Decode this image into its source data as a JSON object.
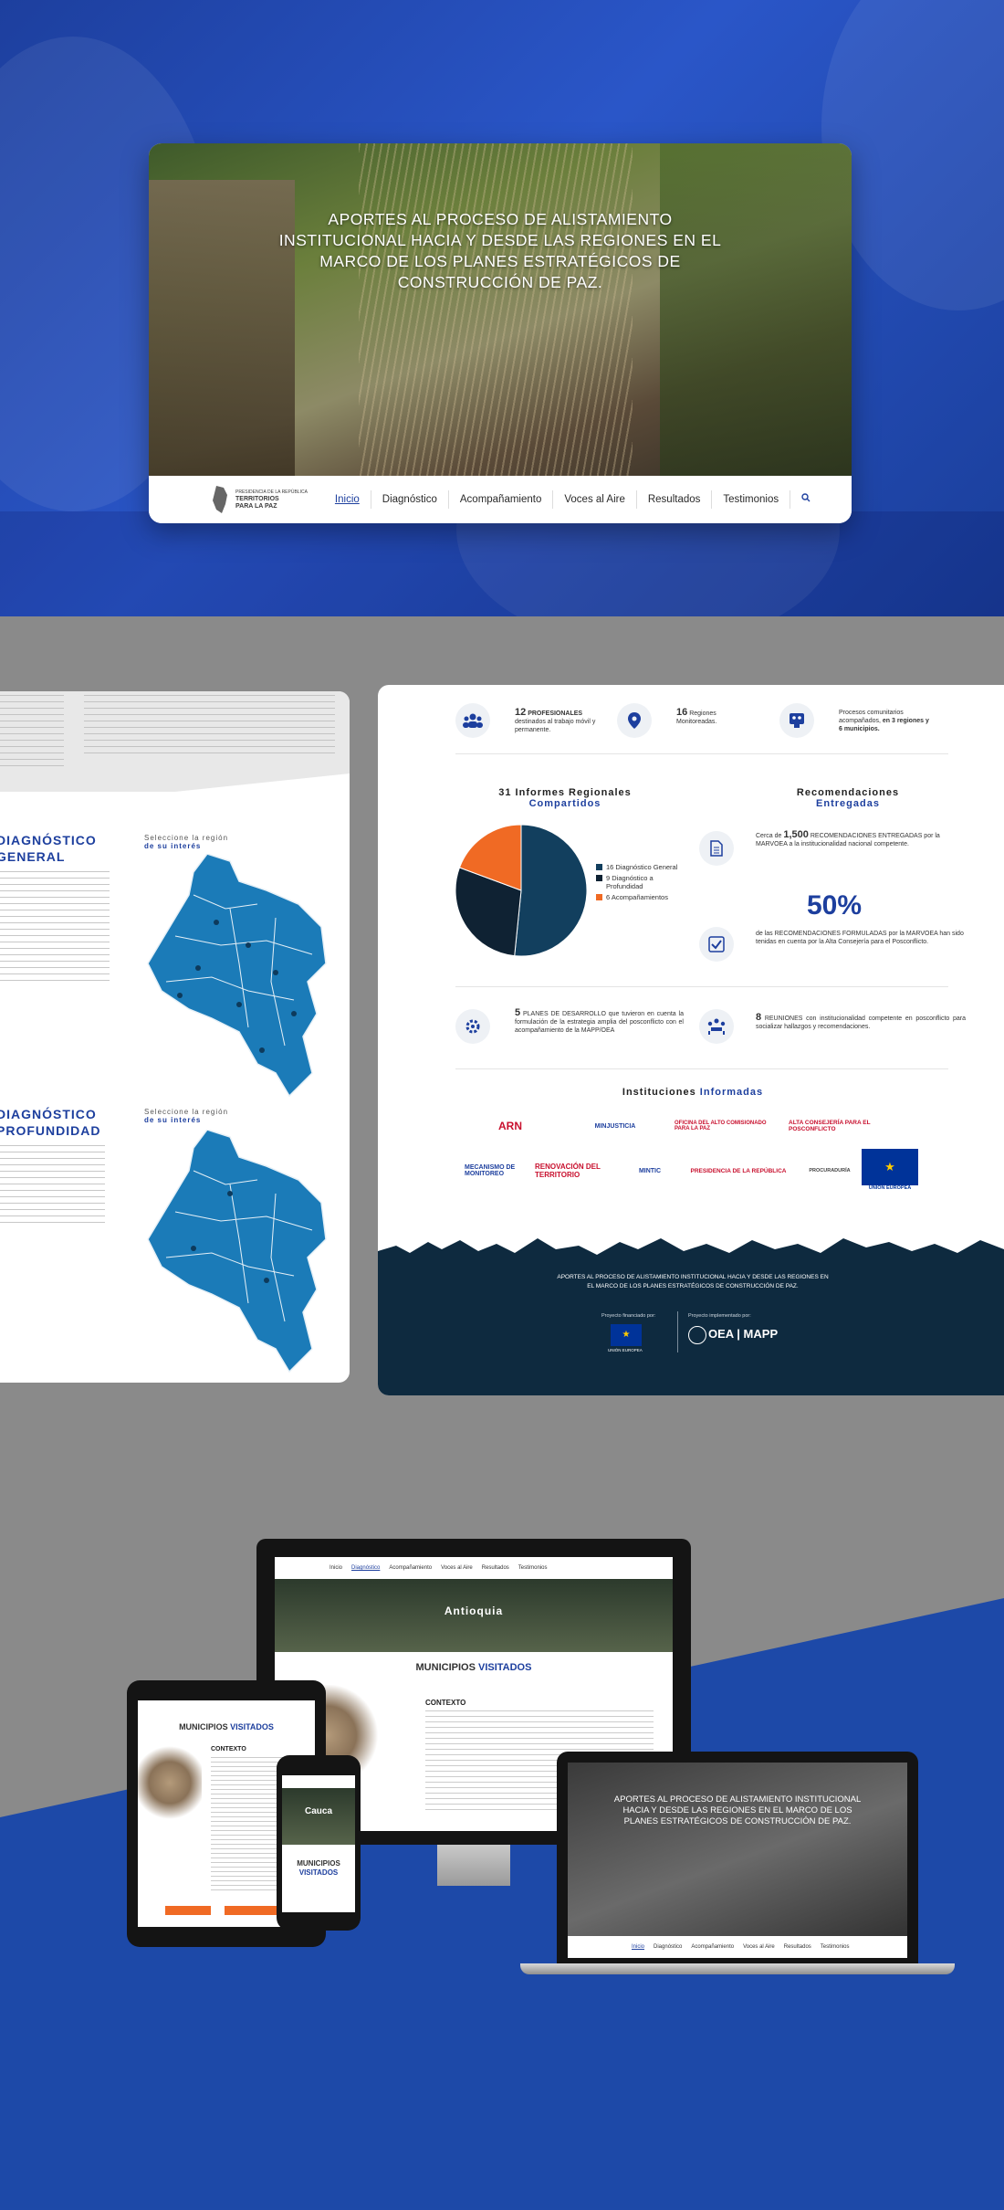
{
  "hero": {
    "title": "APORTES AL PROCESO DE ALISTAMIENTO INSTITUCIONAL HACIA Y DESDE LAS REGIONES EN EL MARCO DE LOS PLANES ESTRATÉGICOS DE CONSTRUCCIÓN DE PAZ.",
    "logo_line1": "PRESIDENCIA DE LA REPÚBLICA",
    "logo_line2": "TERRITORIOS",
    "logo_line3": "PARA LA PAZ",
    "nav": [
      "Inicio",
      "Diagnóstico",
      "Acompañamiento",
      "Voces al Aire",
      "Resultados",
      "Testimonios"
    ]
  },
  "left_panel": {
    "diag1_title": "DIAGNÓSTICO",
    "diag1_sub": "GENERAL",
    "diag2_title": "DIAGNÓSTICO",
    "diag2_sub": "PROFUNDIDAD",
    "select1_a": "Seleccione la región",
    "select1_b": "de su interés",
    "select2_a": "Seleccione la región",
    "select2_b": "de su interés",
    "map_color": "#1b7bb8"
  },
  "stats": {
    "s1_num": "12",
    "s1_label": "PROFESIONALES",
    "s1_desc": "destinados al trabajo móvil y permanente.",
    "s2_num": "16",
    "s2_label": "Regiones Monitoreadas.",
    "s3_desc": "Procesos comunitarios acompañados,",
    "s3_bold": "en 3 regiones y 6 municipios."
  },
  "informes": {
    "title_a": "31 Informes Regionales",
    "title_b": "Compartidos"
  },
  "chart_data": {
    "type": "pie",
    "categories": [
      "16 Diagnóstico General",
      "9 Diagnóstico a Profundidad",
      "6 Acompañamientos"
    ],
    "values": [
      16,
      9,
      6
    ],
    "colors": [
      "#123f5e",
      "#0f2233",
      "#f06a24"
    ]
  },
  "recomendaciones": {
    "title_a": "Recomendaciones",
    "title_b": "Entregadas",
    "r1_pre": "Cerca de",
    "r1_num": "1,500",
    "r1_text": "RECOMENDACIONES ENTREGADAS por la MARVOEA a la institucionalidad nacional competente.",
    "pct": "50%",
    "r2_text": "de las RECOMENDACIONES FORMULADAS por la MARVOEA han sido tenidas en cuenta por la Alta Consejería para el Posconflicto."
  },
  "planes": {
    "num": "5",
    "text": "PLANES DE DESARROLLO que tuvieron en cuenta la formulación de la estrategia amplia del posconflicto con el acompañamiento de la MAPP/OEA",
    "r_num": "8",
    "r_text": "REUNIONES con institucionalidad competente en posconflicto para socializar hallazgos y recomendaciones."
  },
  "instituciones": {
    "title_a": "Instituciones",
    "title_b": "Informadas",
    "logos": [
      "ARN",
      "MINJUSTICIA",
      "OFICINA DEL ALTO COMISIONADO PARA LA PAZ",
      "ALTA CONSEJERÍA PARA EL POSCONFLICTO",
      "MECANISMO DE MONITOREO",
      "RENOVACIÓN DEL TERRITORIO",
      "MINTIC",
      "PRESIDENCIA DE LA REPÚBLICA",
      "PROCURADURÍA",
      "UNIÓN EUROPEA"
    ]
  },
  "footer": {
    "text": "APORTES AL PROCESO DE ALISTAMIENTO INSTITUCIONAL HACIA Y DESDE LAS REGIONES EN EL MARCO DE LOS PLANES ESTRATÉGICOS DE CONSTRUCCIÓN DE PAZ.",
    "financiado": "Proyecto financiado por:",
    "implementado": "Proyecto implementado por:",
    "eu": "UNIÓN EUROPEA",
    "oea": "OEA | MAPP"
  },
  "devices": {
    "desk_region": "Antioquia",
    "desk_heading_a": "MUNICIPIOS",
    "desk_heading_b": "VISITADOS",
    "desk_contexto": "CONTEXTO",
    "tab_heading_a": "MUNICIPIOS",
    "tab_heading_b": "VISITADOS",
    "tab_contexto": "CONTEXTO",
    "phone_region": "Cauca",
    "phone_heading_a": "MUNICIPIOS",
    "phone_heading_b": "VISITADOS",
    "laptop_title": "APORTES AL PROCESO DE ALISTAMIENTO INSTITUCIONAL HACIA Y DESDE LAS REGIONES EN EL MARCO DE LOS PLANES ESTRATÉGICOS DE CONSTRUCCIÓN DE PAZ.",
    "nav": [
      "Inicio",
      "Diagnóstico",
      "Acompañamiento",
      "Voces al Aire",
      "Resultados",
      "Testimonios"
    ]
  }
}
